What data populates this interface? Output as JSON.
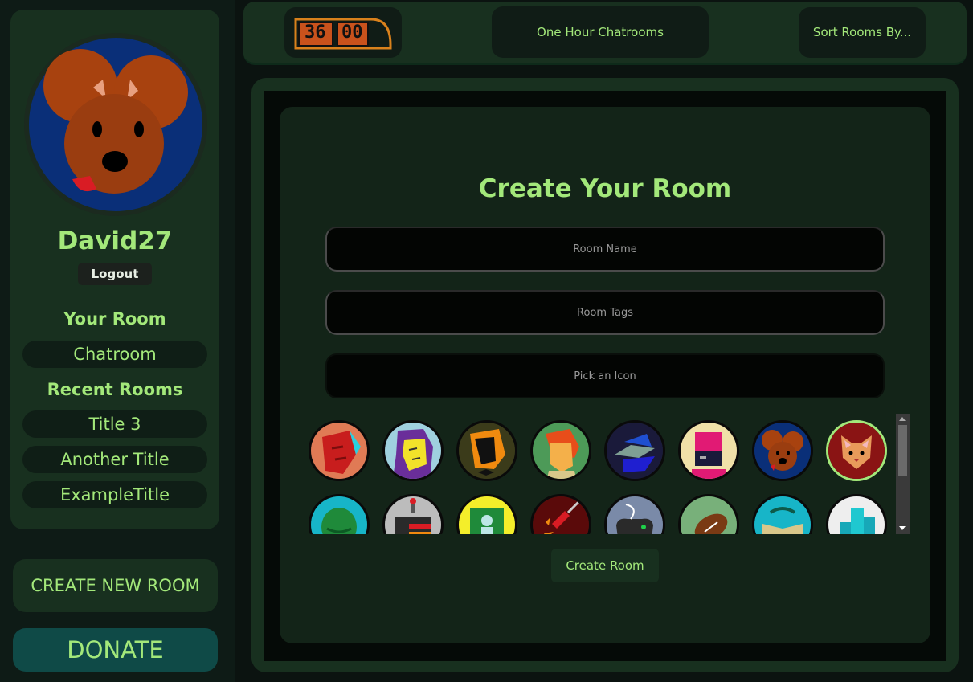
{
  "sidebar": {
    "username": "David27",
    "logout_label": "Logout",
    "your_room_label": "Your Room",
    "your_room": "Chatroom",
    "recent_rooms_label": "Recent Rooms",
    "recent_rooms": [
      "Title 3",
      "Another Title",
      "ExampleTitle"
    ],
    "create_new_label": "CREATE NEW ROOM",
    "donate_label": "DONATE"
  },
  "header": {
    "timer_minutes": "36",
    "timer_seconds": "00",
    "title": "One Hour Chatrooms",
    "sort_label": "Sort Rooms By..."
  },
  "create_room": {
    "title": "Create Your Room",
    "room_name_placeholder": "Room Name",
    "room_tags_placeholder": "Room Tags",
    "icon_placeholder": "Pick an Icon",
    "submit_label": "Create Room",
    "icons": [
      {
        "name": "red-face-icon",
        "selected": false
      },
      {
        "name": "purple-hair-face-icon",
        "selected": false
      },
      {
        "name": "bowtie-man-icon",
        "selected": false
      },
      {
        "name": "redhead-face-icon",
        "selected": false
      },
      {
        "name": "bird-icon",
        "selected": false
      },
      {
        "name": "robot-face-icon",
        "selected": false
      },
      {
        "name": "mouse-icon",
        "selected": false
      },
      {
        "name": "cat-icon",
        "selected": true
      },
      {
        "name": "turtle-icon",
        "selected": false
      },
      {
        "name": "cake-icon",
        "selected": false
      },
      {
        "name": "portrait-icon",
        "selected": false
      },
      {
        "name": "guitar-icon",
        "selected": false
      },
      {
        "name": "gamepad-icon",
        "selected": false
      },
      {
        "name": "football-icon",
        "selected": false
      },
      {
        "name": "book-icon",
        "selected": false
      },
      {
        "name": "city-icon",
        "selected": false
      }
    ]
  },
  "colors": {
    "accent": "#a3e87a",
    "panel": "#18301f",
    "donate": "#0f4a47"
  }
}
